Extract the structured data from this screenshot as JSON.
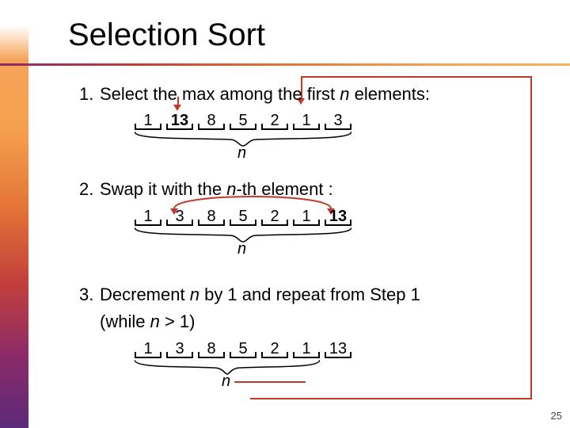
{
  "title": "Selection Sort",
  "step1": {
    "num": "1.",
    "text_a": "Select the max among the first ",
    "em": "n",
    "text_b": " elements:"
  },
  "step2": {
    "num": "2.",
    "text_a": "Swap it with the ",
    "em": "n",
    "text_b": "-th element :"
  },
  "step3": {
    "num": "3.",
    "text_a": "Decrement ",
    "em1": "n",
    "text_b": " by 1 and repeat from Step 1",
    "cont_a": "(while ",
    "em2": "n",
    "cont_b": " > 1)"
  },
  "arrays": {
    "row1": [
      "1",
      "13",
      "8",
      "5",
      "2",
      "1",
      "3"
    ],
    "row2": [
      "1",
      "3",
      "8",
      "5",
      "2",
      "1",
      "13"
    ],
    "row3": [
      "1",
      "3",
      "8",
      "5",
      "2",
      "1",
      "13"
    ]
  },
  "bold": {
    "row1_idx": 1,
    "row2_idx": 6
  },
  "braces": {
    "n_label": "n"
  },
  "page_number": "25"
}
